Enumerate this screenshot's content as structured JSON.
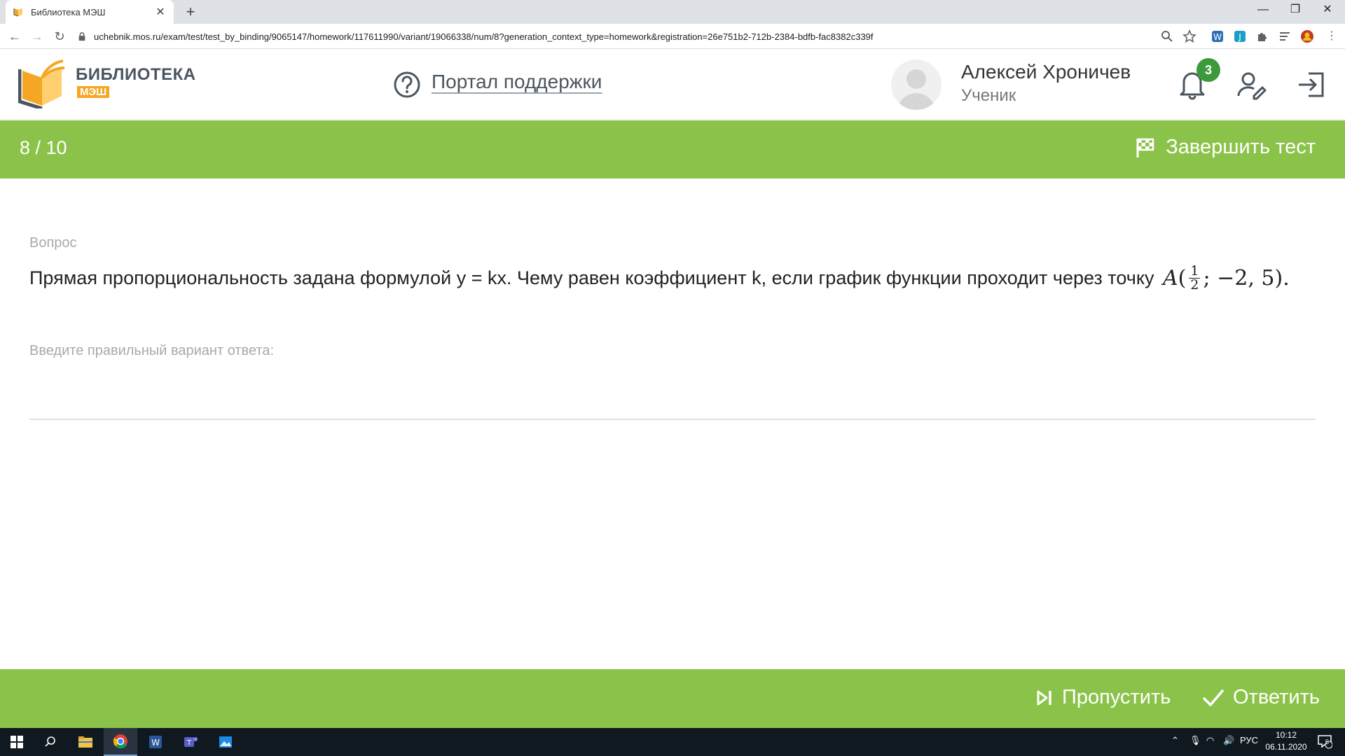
{
  "browser": {
    "tab_title": "Библиотека МЭШ",
    "url": "uchebnik.mos.ru/exam/test/test_by_binding/9065147/homework/117611990/variant/19066338/num/8?generation_context_type=homework&registration=26e751b2-712b-2384-bdfb-fac8382c339f"
  },
  "header": {
    "logo_title": "БИБЛИОТЕКА",
    "logo_subtitle": "МЭШ",
    "support_label": "Портал поддержки",
    "user_name": "Алексей Хроничев",
    "user_role": "Ученик",
    "notifications_count": "3"
  },
  "progress": {
    "counter": "8 / 10",
    "finish_label": "Завершить тест"
  },
  "question": {
    "section_label": "Вопрос",
    "text": "Прямая пропорциональность задана формулой y = kx. Чему равен коэффициент k, если график функции проходит через точку",
    "math_point": "A",
    "math_num": "1",
    "math_den": "2",
    "math_rest": "; −2, 5).",
    "answer_prompt": "Введите правильный вариант ответа:",
    "answer_value": ""
  },
  "footer": {
    "skip_label": "Пропустить",
    "answer_label": "Ответить"
  },
  "taskbar": {
    "lang": "РУС",
    "time": "10:12",
    "date": "06.11.2020",
    "notification_count": "5"
  },
  "colors": {
    "accent_green": "#8bc34a",
    "badge_green": "#3c9a3c",
    "logo_orange": "#f5a623"
  }
}
